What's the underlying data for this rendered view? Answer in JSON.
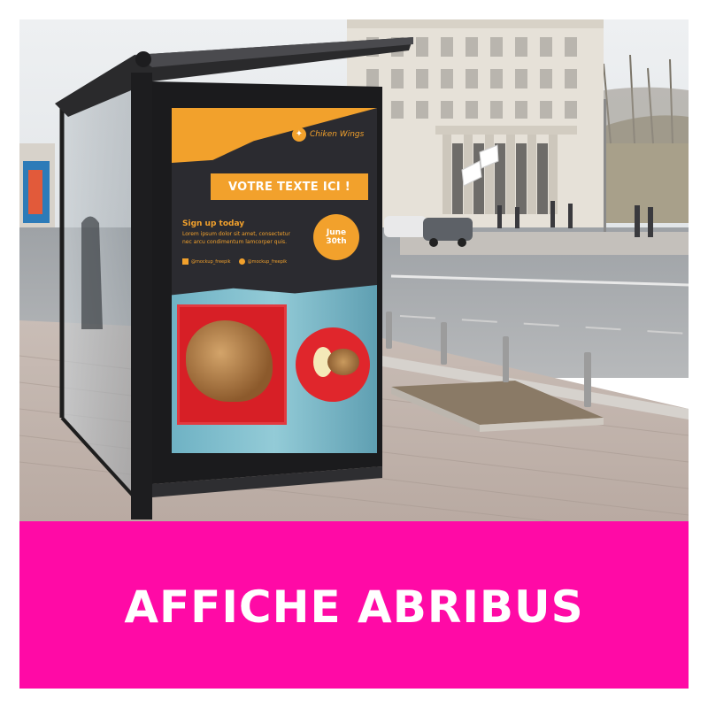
{
  "banner": {
    "title": "AFFICHE ABRIBUS",
    "background_color": "#ff0aa6",
    "text_color": "#ffffff"
  },
  "poster": {
    "brand": "Chiken Wings",
    "headline": "VOTRE TEXTE ICI !",
    "subheading": "Sign up today",
    "body_line_1": "Lorem ipsum dolor sit amet, consectetur",
    "body_line_2": "nec arcu condimentum lamcorper quis.",
    "date_line_1": "June",
    "date_line_2": "30th",
    "social_1": "@mockup_freepik",
    "social_2": "@mockup_freepik",
    "accent_color": "#f2a12c",
    "dark_color": "#2b2b30"
  },
  "icons": [
    "chicken-logo-icon",
    "facebook-icon",
    "twitter-icon"
  ]
}
